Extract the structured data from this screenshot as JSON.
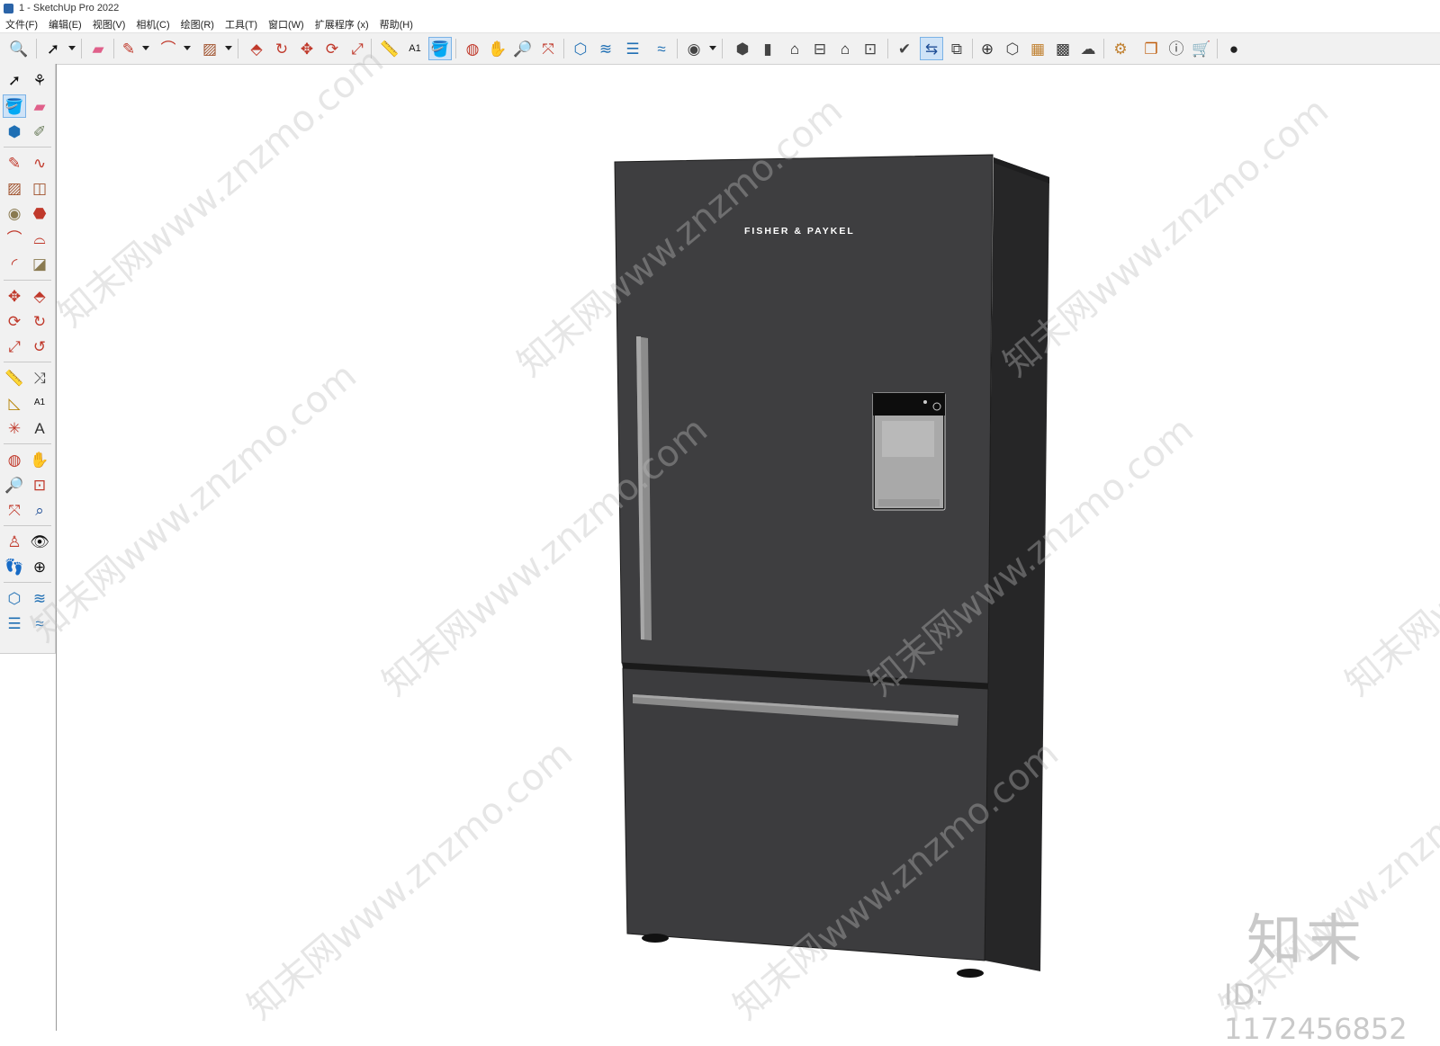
{
  "window": {
    "title": "1 - SketchUp Pro 2022"
  },
  "menu": [
    "文件(F)",
    "编辑(E)",
    "视图(V)",
    "相机(C)",
    "绘图(R)",
    "工具(T)",
    "窗口(W)",
    "扩展程序 (x)",
    "帮助(H)"
  ],
  "model": {
    "brand_label": "FISHER & PAYKEL"
  },
  "watermark": {
    "text": "知末网www.znzmo.com",
    "logo": "知末",
    "id": "ID: 1172456852"
  },
  "colors": {
    "fridge_body": "#3d3d3f",
    "fridge_side": "#2a2a2b",
    "handle": "#8a8a8a",
    "toolbar_bg": "#f1f1f1",
    "active_tool": "#cfe3f7"
  },
  "active_tool": "paint-bucket"
}
